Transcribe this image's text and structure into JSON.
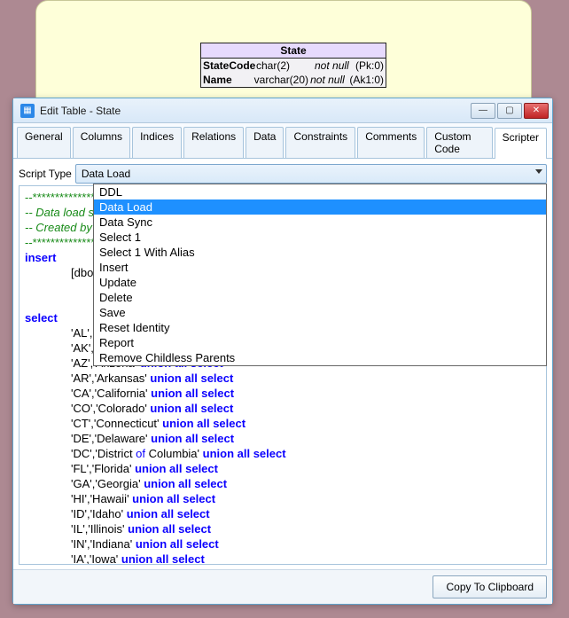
{
  "diagram": {
    "title": "State",
    "rows": [
      {
        "name": "StateCode",
        "type": "char(2)",
        "null": "not null",
        "key": "(Pk:0)"
      },
      {
        "name": "Name",
        "type": "varchar(20)",
        "null": "not null",
        "key": "(Ak1:0)"
      }
    ]
  },
  "window": {
    "title": "Edit Table - State",
    "tabs": [
      "General",
      "Columns",
      "Indices",
      "Relations",
      "Data",
      "Constraints",
      "Comments",
      "Custom Code",
      "Scripter"
    ],
    "activeTab": "Scripter",
    "scriptTypeLabel": "Script Type",
    "selected": "Data Load",
    "options": [
      "DDL",
      "Data Load",
      "Data Sync",
      "Select 1",
      "Select 1 With Alias",
      "Insert",
      "Update",
      "Delete",
      "Save",
      "Reset Identity",
      "Report",
      "Remove Childless Parents"
    ],
    "copyLabel": "Copy To Clipboard"
  },
  "script": {
    "bar": "--************************************************************",
    "cmt1": "--     Data load script for State",
    "cmt2": "--     Created by",
    "kwInsert": "insert",
    "lineInsert": "[dbo].[State] ([StateCode],[Name])",
    "kwSelect": "select",
    "union": "union all select",
    "of": "of",
    "rows": [
      {
        "a": "'AL','Alabama' "
      },
      {
        "a": "'AK','Alaska' "
      },
      {
        "a": "'AZ','Arizona' "
      },
      {
        "a": "'AR','Arkansas' "
      },
      {
        "a": "'CA','California' "
      },
      {
        "a": "'CO','Colorado' "
      },
      {
        "a": "'CT','Connecticut' "
      },
      {
        "a": "'DE','Delaware' "
      },
      {
        "a": "'DC','District ",
        "of": "of",
        "b": " Columbia' "
      },
      {
        "a": "'FL','Florida' "
      },
      {
        "a": "'GA','Georgia' "
      },
      {
        "a": "'HI','Hawaii' "
      },
      {
        "a": "'ID','Idaho' "
      },
      {
        "a": "'IL','Illinois' "
      },
      {
        "a": "'IN','Indiana' "
      },
      {
        "a": "'IA','Iowa' "
      }
    ]
  }
}
